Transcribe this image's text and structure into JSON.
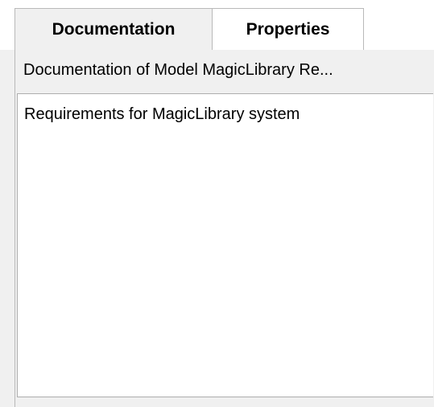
{
  "tabs": {
    "documentation": "Documentation",
    "properties": "Properties"
  },
  "header": {
    "title": "Documentation of Model MagicLibrary Re..."
  },
  "editor": {
    "content": "Requirements for MagicLibrary system"
  }
}
